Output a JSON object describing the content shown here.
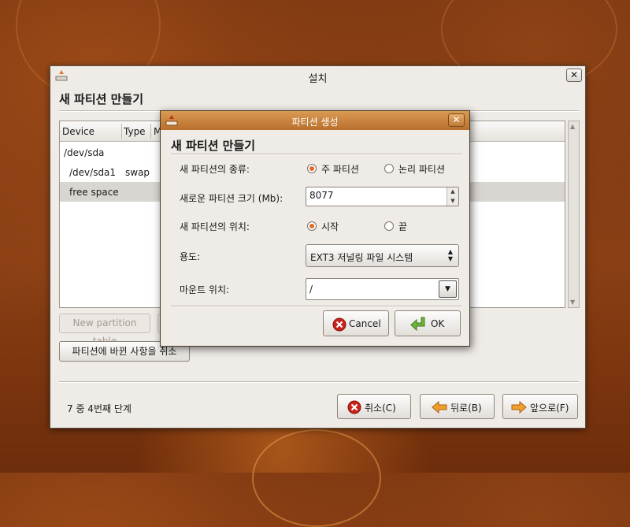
{
  "main_window": {
    "title": "설치",
    "close_label": "✕",
    "heading": "새 파티션 만들기",
    "table": {
      "columns": [
        "Device",
        "Type",
        "M"
      ],
      "rows": [
        {
          "device": "/dev/sda",
          "type": ""
        },
        {
          "device": "/dev/sda1",
          "type": "swap"
        },
        {
          "device": "free space",
          "type": ""
        }
      ]
    },
    "new_partition_table_label": "New partition table",
    "revert_label": "파티션에 바뀐 사항을 취소",
    "step_text": "7 중 4번째 단계",
    "cancel_label": "취소(C)",
    "back_label": "뒤로(B)",
    "forward_label": "앞으로(F)"
  },
  "dialog": {
    "title": "파티션 생성",
    "close_label": "✕",
    "heading": "새 파티션 만들기",
    "type_label": "새 파티션의 종류:",
    "type_options": [
      "주 파티션",
      "논리 파티션"
    ],
    "type_selected": "주 파티션",
    "size_label": "새로운 파티션 크기 (Mb):",
    "size_value": "8077",
    "location_label": "새 파티션의 위치:",
    "location_options": [
      "시작",
      "끝"
    ],
    "location_selected": "시작",
    "use_label": "용도:",
    "use_value": "EXT3 저널링 파일 시스템",
    "mount_label": "마운트 위치:",
    "mount_value": "/",
    "cancel_label": "Cancel",
    "ok_label": "OK"
  },
  "colors": {
    "dialog_title": "#c57d38",
    "radio_selected": "#e2692a",
    "window_bg": "#efebe7"
  },
  "icons": [
    "installer-app-icon",
    "close-icon",
    "cancel-icon",
    "ok-icon",
    "back-arrow-icon",
    "forward-arrow-icon",
    "spin-up-icon",
    "spin-down-icon",
    "dropdown-arrow-icon"
  ]
}
